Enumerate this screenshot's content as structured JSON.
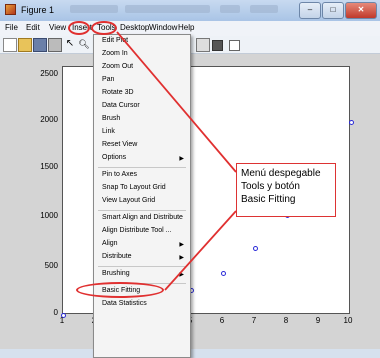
{
  "window": {
    "title": "Figure 1"
  },
  "window_controls": {
    "minimize": "–",
    "maximize": "□",
    "close": "✕"
  },
  "menubar": {
    "items": [
      "File",
      "Edit",
      "View",
      "Insert",
      "Tools",
      "Desktop",
      "Window",
      "Help"
    ]
  },
  "tools_menu": {
    "items": [
      {
        "label": "Edit Plot",
        "submenu": false
      },
      {
        "label": "Zoom In",
        "submenu": false
      },
      {
        "label": "Zoom Out",
        "submenu": false
      },
      {
        "label": "Pan",
        "submenu": false
      },
      {
        "label": "Rotate 3D",
        "submenu": false
      },
      {
        "label": "Data Cursor",
        "submenu": false
      },
      {
        "label": "Brush",
        "submenu": false
      },
      {
        "label": "Link",
        "submenu": false
      },
      {
        "label": "Reset View",
        "submenu": false
      },
      {
        "label": "Options",
        "submenu": true
      },
      {
        "label": "Pin to Axes",
        "submenu": false
      },
      {
        "label": "Snap To Layout Grid",
        "submenu": false
      },
      {
        "label": "View Layout Grid",
        "submenu": false
      },
      {
        "label": "Smart Align and Distribute",
        "submenu": false
      },
      {
        "label": "Align Distribute Tool ...",
        "submenu": false
      },
      {
        "label": "Align",
        "submenu": true
      },
      {
        "label": "Distribute",
        "submenu": true
      },
      {
        "label": "Brushing",
        "submenu": true
      },
      {
        "label": "Basic Fitting",
        "submenu": false
      },
      {
        "label": "Data Statistics",
        "submenu": false
      }
    ]
  },
  "callout": {
    "lines": [
      "Menú despegable",
      "Tools y botón",
      "Basic Fitting"
    ]
  },
  "plot": {
    "y_ticks": [
      "2500",
      "2000",
      "1500",
      "1000",
      "500",
      "0"
    ],
    "x_ticks": [
      "1",
      "2",
      "3",
      "4",
      "5",
      "6",
      "7",
      "8",
      "9",
      "10"
    ]
  },
  "chart_data": {
    "type": "scatter",
    "x": [
      1,
      2,
      3,
      4,
      5,
      6,
      7,
      8,
      9,
      10
    ],
    "y": [
      0,
      20,
      70,
      150,
      260,
      440,
      700,
      1040,
      1480,
      2020
    ],
    "xlim": [
      1,
      10
    ],
    "ylim": [
      0,
      2600
    ],
    "marker_color": "#2b2bd8"
  }
}
